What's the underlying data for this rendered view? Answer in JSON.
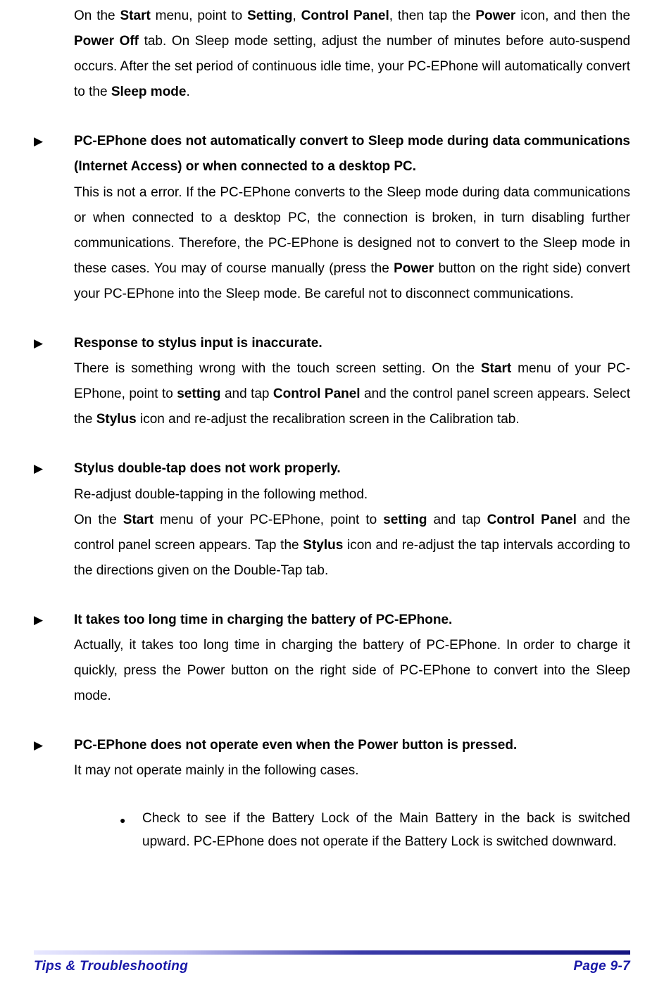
{
  "intro": {
    "html": "On the <b>Start</b> menu, point to <b>Setting</b>, <b>Control Panel</b>, then tap the <b>Power</b> icon, and then the <b>Power Off</b> tab. On Sleep mode setting, adjust the number of minutes before auto-suspend occurs. After the set period of continuous idle time, your PC-EPhone will automatically convert to the <b>Sleep mode</b>."
  },
  "items": [
    {
      "title": "PC-EPhone does not automatically convert to Sleep mode during data communications (Internet Access) or when connected to a desktop PC.",
      "body_html": "This is not a error. If the PC-EPhone converts to the Sleep mode during data communications or when connected to a desktop PC, the connection is broken, in turn disabling further communications. Therefore, the PC-EPhone is designed not to convert to the Sleep mode in these cases. You may of course manually (press the <b>Power</b> button on the right side) convert your PC-EPhone into the Sleep mode. Be careful not to disconnect communications."
    },
    {
      "title": "Response to stylus input is inaccurate.",
      "body_html": "There is something wrong with the touch screen setting. On the <b>Start</b> menu of your PC-EPhone, point to <b>setting</b> and tap <b>Control Panel</b> and the control panel screen appears. Select the <b>Stylus</b> icon and re-adjust the recalibration screen in the Calibration tab."
    },
    {
      "title": "Stylus double-tap does not work properly.",
      "body_html": "Re-adjust double-tapping in the following method.<br>On the <b>Start</b> menu of your PC-EPhone, point to <b>setting</b> and tap <b>Control Panel</b> and the control panel screen appears. Tap the <b>Stylus</b> icon and re-adjust the tap intervals according to the directions given on the Double-Tap tab."
    },
    {
      "title": "It takes too long time in charging the battery of PC-EPhone.",
      "body_html": "Actually, it takes too long time in charging the battery of PC-EPhone. In order to charge it quickly, press the Power button on the right side of PC-EPhone to convert into the Sleep mode."
    },
    {
      "title": "PC-EPhone does not operate even when the Power button is pressed.",
      "body_html": "It may not operate mainly in the following cases.",
      "subitems": [
        "Check to see if the Battery Lock of the Main Battery in the back is switched upward. PC-EPhone does not operate if the Battery Lock is switched downward."
      ]
    }
  ],
  "footer": {
    "left": "Tips & Troubleshooting",
    "right": "Page 9-7"
  },
  "glyphs": {
    "triangle": "▶",
    "dot": "●"
  }
}
